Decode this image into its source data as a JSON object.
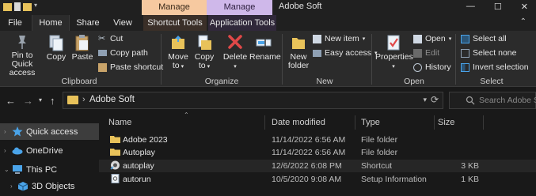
{
  "title_bar": {
    "window_title": "Adobe Soft",
    "context_tab_1": "Manage",
    "context_tab_2": "Manage",
    "minimize": "—",
    "maximize": "☐",
    "close": "✕"
  },
  "tabs": {
    "file": "File",
    "home": "Home",
    "share": "Share",
    "view": "View",
    "shortcut_tools": "Shortcut Tools",
    "application_tools": "Application Tools"
  },
  "ribbon": {
    "clipboard": {
      "label": "Clipboard",
      "pin_line1": "Pin to Quick",
      "pin_line2": "access",
      "copy": "Copy",
      "paste": "Paste",
      "cut": "Cut",
      "copy_path": "Copy path",
      "paste_shortcut": "Paste shortcut"
    },
    "organize": {
      "label": "Organize",
      "move_to_1": "Move",
      "move_to_2": "to",
      "copy_to_1": "Copy",
      "copy_to_2": "to",
      "delete": "Delete",
      "rename": "Rename"
    },
    "new": {
      "label": "New",
      "new_folder_1": "New",
      "new_folder_2": "folder",
      "new_item": "New item",
      "easy_access": "Easy access"
    },
    "open": {
      "label": "Open",
      "properties": "Properties",
      "open": "Open",
      "edit": "Edit",
      "history": "History"
    },
    "select": {
      "label": "Select",
      "select_all": "Select all",
      "select_none": "Select none",
      "invert_selection": "Invert selection"
    }
  },
  "address": {
    "path": "Adobe Soft",
    "search_placeholder": "Search Adobe Soft"
  },
  "nav_pane": {
    "items": [
      {
        "label": "Quick access",
        "icon": "star-icon",
        "selected": true
      },
      {
        "label": "OneDrive",
        "icon": "cloud-icon",
        "selected": false
      },
      {
        "label": "This PC",
        "icon": "monitor-icon",
        "selected": false
      },
      {
        "label": "3D Objects",
        "icon": "cube-icon",
        "selected": false
      }
    ]
  },
  "columns": {
    "name": "Name",
    "date_modified": "Date modified",
    "type": "Type",
    "size": "Size"
  },
  "files": [
    {
      "name": "Adobe 2023",
      "date": "11/14/2022 6:56 AM",
      "type": "File folder",
      "size": "",
      "icon": "folder-icon"
    },
    {
      "name": "Autoplay",
      "date": "11/14/2022 6:56 AM",
      "type": "File folder",
      "size": "",
      "icon": "folder-icon"
    },
    {
      "name": "autoplay",
      "date": "12/6/2022 6:08 PM",
      "type": "Shortcut",
      "size": "3 KB",
      "icon": "shortcut-icon"
    },
    {
      "name": "autorun",
      "date": "10/5/2020 9:08 AM",
      "type": "Setup Information",
      "size": "1 KB",
      "icon": "settings-file-icon"
    }
  ],
  "colors": {
    "folder": "#e8c25a",
    "manage_shortcut": "#f6c9a0",
    "manage_app": "#cfb8ea",
    "delete_red": "#e04848",
    "accent_blue": "#4aa3e8"
  }
}
